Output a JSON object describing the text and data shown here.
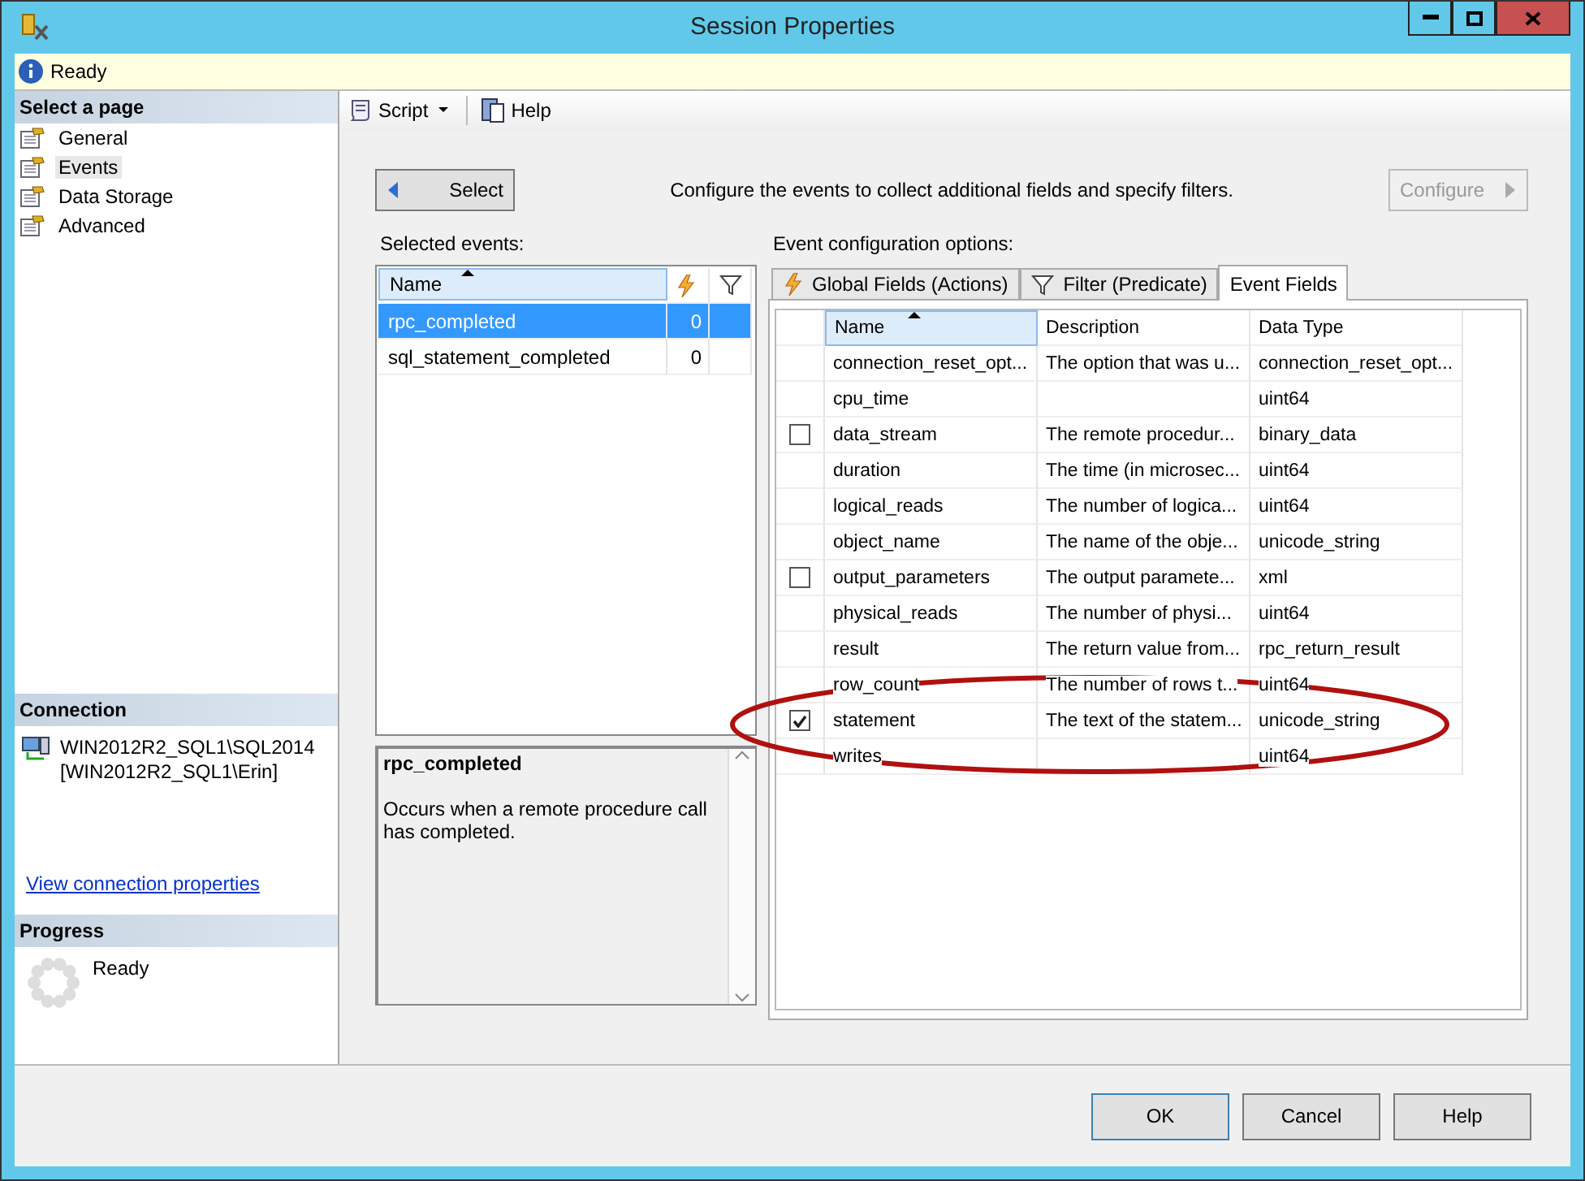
{
  "window": {
    "title": "Session Properties"
  },
  "status": {
    "text": "Ready"
  },
  "sidebar": {
    "select_page": {
      "header": "Select a page",
      "pages": [
        {
          "label": "General",
          "selected": false
        },
        {
          "label": "Events",
          "selected": true
        },
        {
          "label": "Data Storage",
          "selected": false
        },
        {
          "label": "Advanced",
          "selected": false
        }
      ]
    },
    "connection": {
      "header": "Connection",
      "server": "WIN2012R2_SQL1\\SQL2014",
      "user": "[WIN2012R2_SQL1\\Erin]",
      "link": "View connection properties"
    },
    "progress": {
      "header": "Progress",
      "status": "Ready"
    }
  },
  "toolbar": {
    "script": "Script",
    "help": "Help"
  },
  "select_button": "Select",
  "instructions": "Configure the events to collect additional fields and specify filters.",
  "configure_button": {
    "label": "Configure",
    "disabled": true
  },
  "selected_events": {
    "label": "Selected events:",
    "columns": [
      "Name"
    ],
    "rows": [
      {
        "name": "rpc_completed",
        "actions": "0",
        "selected": true
      },
      {
        "name": "sql_statement_completed",
        "actions": "0",
        "selected": false
      }
    ]
  },
  "event_description": {
    "title": "rpc_completed",
    "text": "Occurs when a remote procedure call has completed."
  },
  "event_config": {
    "label": "Event configuration options:",
    "tabs": [
      {
        "label": "Global Fields (Actions)",
        "kind": "actions",
        "selected": false
      },
      {
        "label": "Filter (Predicate)",
        "kind": "filter",
        "selected": false
      },
      {
        "label": "Event Fields",
        "kind": "plain",
        "selected": true
      }
    ],
    "columns": [
      "Name",
      "Description",
      "Data Type"
    ],
    "rows": [
      {
        "kind": "plain",
        "name": "connection_reset_opt...",
        "description": "The option that was u...",
        "data_type": "connection_reset_opt..."
      },
      {
        "kind": "plain",
        "name": "cpu_time",
        "data_type": "uint64"
      },
      {
        "kind": "checkbox",
        "checked": false,
        "name": "data_stream",
        "description": "The remote procedur...",
        "data_type": "binary_data"
      },
      {
        "kind": "plain",
        "name": "duration",
        "description": "The time (in microsec...",
        "data_type": "uint64"
      },
      {
        "kind": "plain",
        "name": "logical_reads",
        "description": "The number of logica...",
        "data_type": "uint64"
      },
      {
        "kind": "plain",
        "name": "object_name",
        "description": "The name of the obje...",
        "data_type": "unicode_string"
      },
      {
        "kind": "checkbox",
        "checked": false,
        "name": "output_parameters",
        "description": "The output paramete...",
        "data_type": "xml"
      },
      {
        "kind": "plain",
        "name": "physical_reads",
        "description": "The number of physi...",
        "data_type": "uint64"
      },
      {
        "kind": "plain",
        "name": "result",
        "description": "The return value from...",
        "data_type": "rpc_return_result"
      },
      {
        "kind": "plain",
        "name": "row_count",
        "description": "The number of rows t...",
        "data_type": "uint64"
      },
      {
        "kind": "checkbox",
        "checked": true,
        "name": "statement",
        "description": "The text of the statem...",
        "data_type": "unicode_string"
      },
      {
        "kind": "plain",
        "name": "writes",
        "data_type": "uint64"
      }
    ]
  },
  "buttons": [
    {
      "label": "OK",
      "kind": "default"
    },
    {
      "label": "Cancel",
      "kind": "normal"
    },
    {
      "label": "Help",
      "kind": "normal"
    }
  ]
}
